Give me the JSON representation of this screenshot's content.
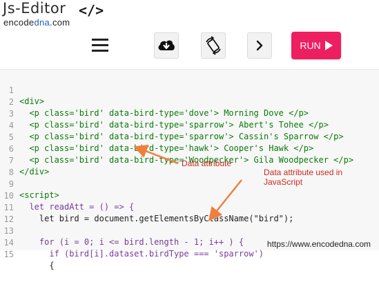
{
  "brand": {
    "title": "Js-Editor",
    "code_icon": "</>",
    "site_prefix": "encode",
    "site_accent": "dna",
    "site_suffix": ".com"
  },
  "toolbar": {
    "menu_icon": "hamburger-icon",
    "download_icon": "cloud-download-icon",
    "rotate_icon": "rotate-icon",
    "next_icon": "chevron-right-icon",
    "run_label": "RUN"
  },
  "editor": {
    "line_numbers": [
      "1",
      "2",
      "3",
      "4",
      "5",
      "6",
      "7",
      "8",
      "9",
      "10",
      "11",
      "12",
      "13",
      "14",
      "15"
    ],
    "lines": [
      "<div>",
      "  <p class='bird' data-bird-type='dove'> Morning Dove </p>",
      "  <p class='bird' data-bird-type='sparrow'> Abert's Tohee </p>",
      "  <p class='bird' data-bird-type='sparrow'> Cassin's Sparrow </p>",
      "  <p class='bird' data-bird-type='hawk'> Cooper's Hawk </p>",
      "  <p class='bird' data-bird-type='Woodpecker'> Gila Woodpecker </p>",
      "</div>",
      "",
      "<script>",
      "  let readAtt = () => {",
      "    let bird = document.getElementsByClassName(\"bird\");",
      "",
      "    for (i = 0; i <= bird.length - 1; i++ ) {",
      "      if (bird[i].dataset.birdType === 'sparrow')",
      "      {"
    ]
  },
  "annotations": {
    "data_attribute": "Data attribute",
    "data_attribute_js": "Data attribute used in JavaScript"
  },
  "footer": {
    "url": "https://www.encodedna.com"
  },
  "colors": {
    "run_button": "#ee1f61",
    "annotation": "#c62b1e",
    "arrow": "#f07f3c",
    "tag": "#0a7a0a",
    "string": "#b84a00",
    "attribute": "#7a3b97"
  }
}
